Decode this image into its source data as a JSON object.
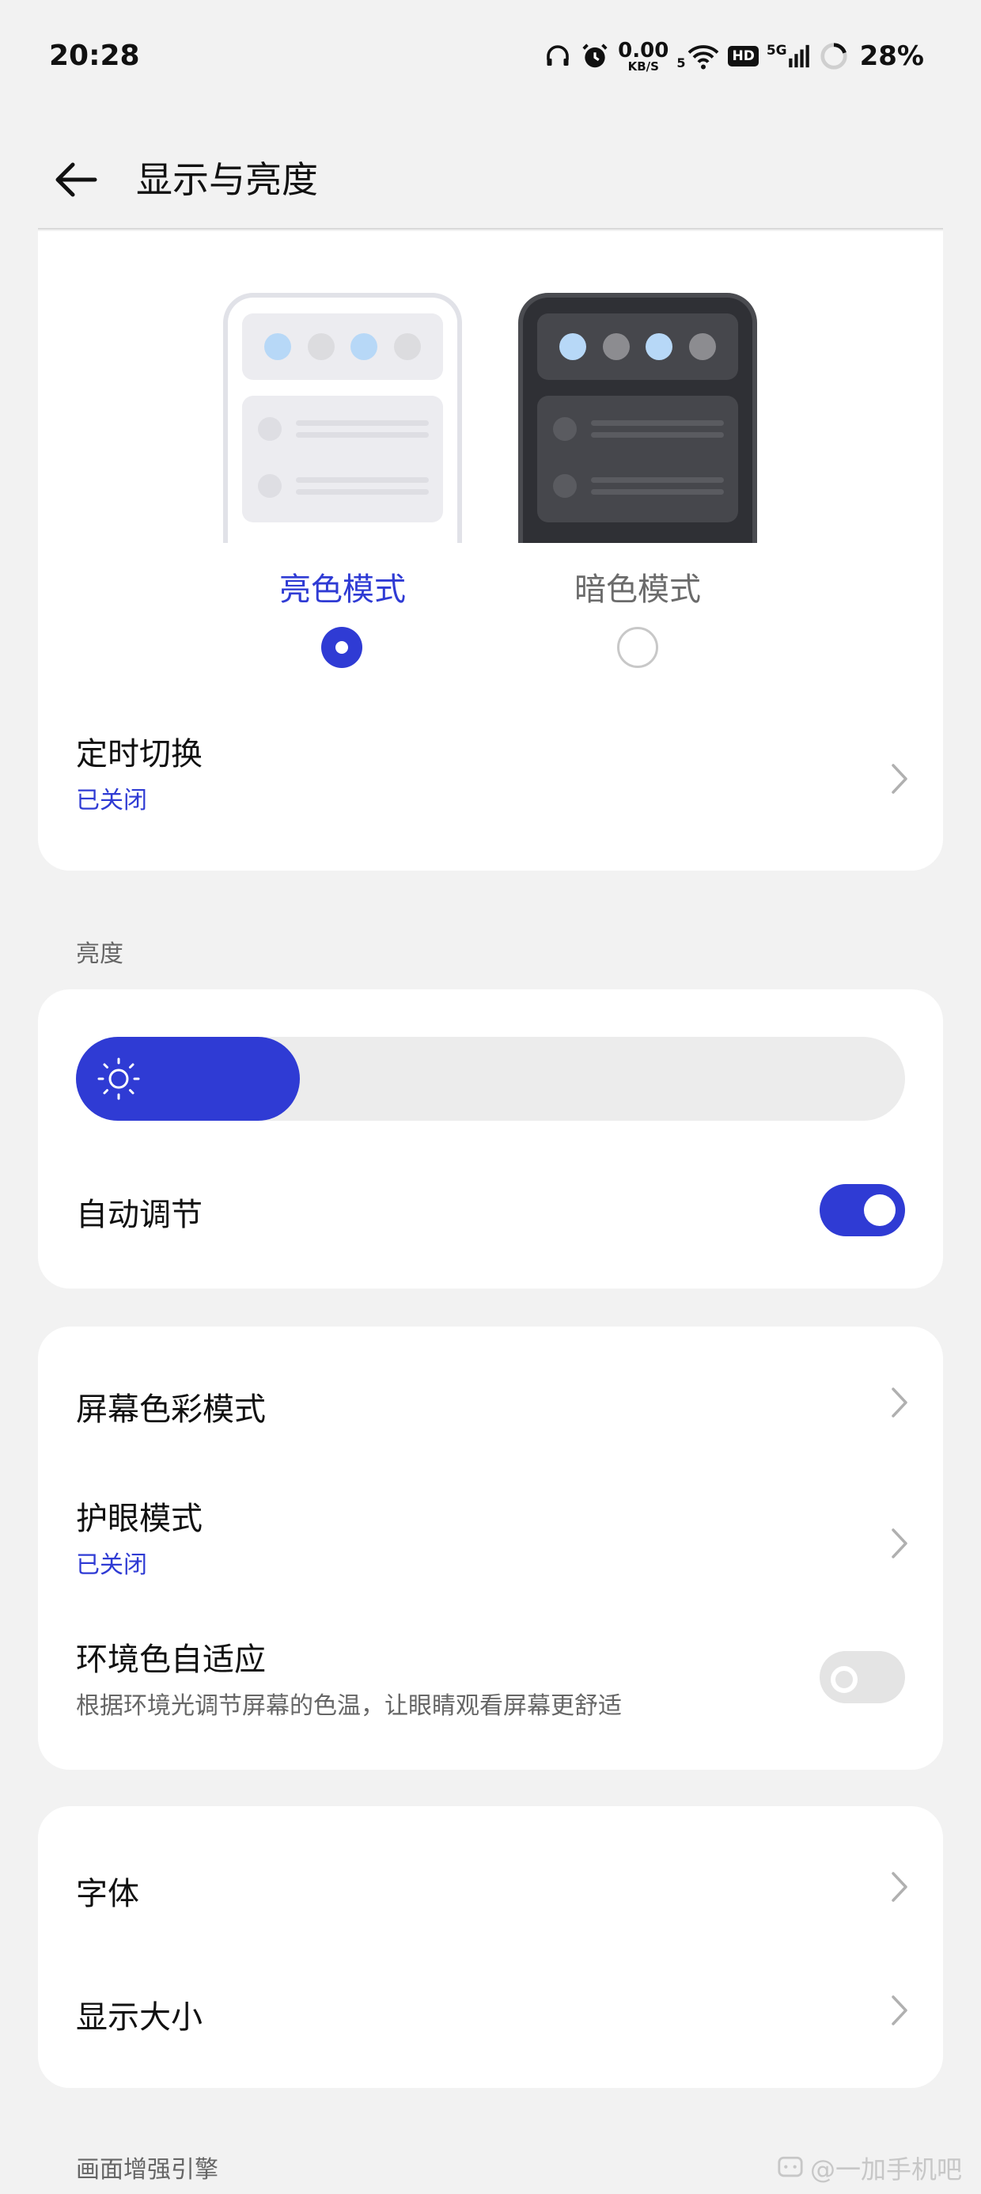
{
  "status_bar": {
    "time": "20:28",
    "net_speed_value": "0.00",
    "net_speed_unit": "KB/S",
    "wifi_label": "5",
    "hd_label": "HD",
    "signal_label": "5G",
    "battery_percent": "28%"
  },
  "header": {
    "title": "显示与亮度"
  },
  "theme": {
    "light_label": "亮色模式",
    "dark_label": "暗色模式",
    "selected": "light"
  },
  "schedule": {
    "label": "定时切换",
    "status": "已关闭"
  },
  "brightness": {
    "section_label": "亮度",
    "level_fraction": 0.27,
    "auto_label": "自动调节",
    "auto_on": true
  },
  "display_settings": {
    "color_mode_label": "屏幕色彩模式",
    "eye_care_label": "护眼模式",
    "eye_care_status": "已关闭",
    "ambient_label": "环境色自适应",
    "ambient_desc": "根据环境光调节屏幕的色温，让眼睛观看屏幕更舒适",
    "ambient_on": false
  },
  "font_settings": {
    "font_label": "字体",
    "size_label": "显示大小"
  },
  "next_section_label": "画面增强引擎",
  "watermark": "@一加手机吧",
  "colors": {
    "accent": "#2f3bd4",
    "background": "#f2f2f2",
    "card": "#ffffff"
  }
}
